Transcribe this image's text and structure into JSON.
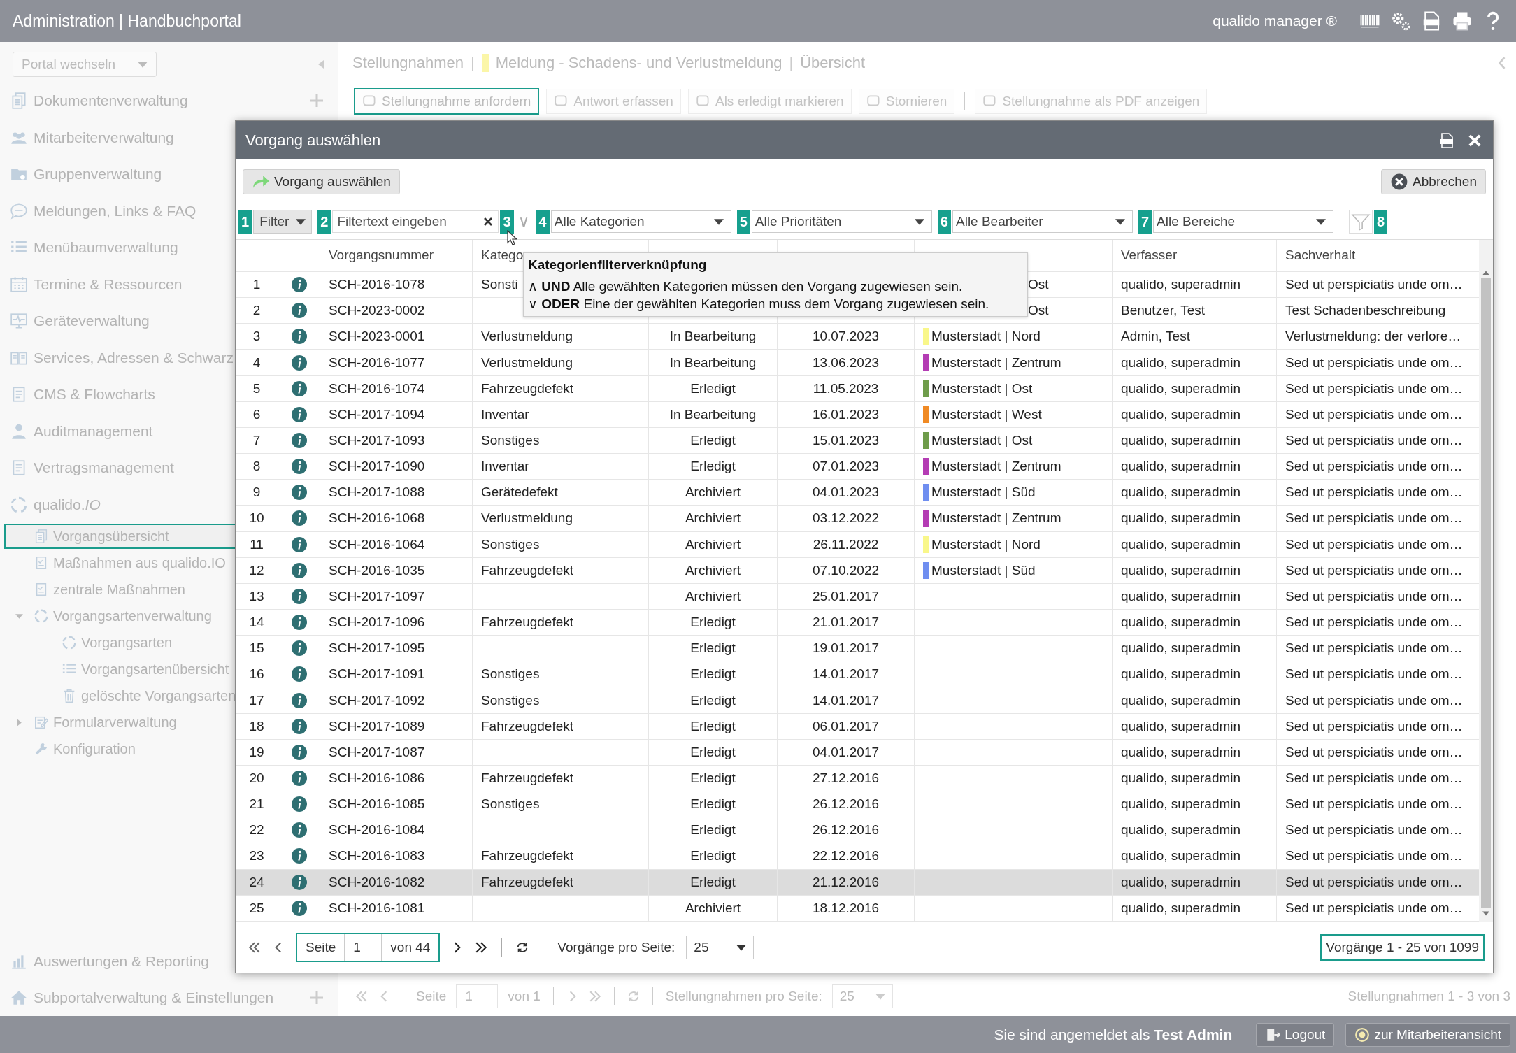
{
  "header": {
    "title": "Administration | Handbuchportal",
    "product": "qualido manager ®"
  },
  "sidebar": {
    "portal_select": "Portal wechseln",
    "items": [
      {
        "label": "Dokumentenverwaltung",
        "add": true
      },
      {
        "label": "Mitarbeiterverwaltung"
      },
      {
        "label": "Gruppenverwaltung"
      },
      {
        "label": "Meldungen, Links & FAQ"
      },
      {
        "label": "Menübaumverwaltung"
      },
      {
        "label": "Termine & Ressourcen"
      },
      {
        "label": "Geräteverwaltung"
      },
      {
        "label": "Services, Adressen & Schwarz"
      },
      {
        "label": "CMS & Flowcharts"
      },
      {
        "label": "Auditmanagement"
      },
      {
        "label": "Vertragsmanagement"
      }
    ],
    "tree": {
      "label": "qualido.*IO*",
      "children": [
        {
          "label": "Vorgangsübersicht",
          "selected": true
        },
        {
          "label": "Maßnahmen aus qualido.IO",
          "selected": false
        },
        {
          "label": "zentrale Maßnahmen",
          "selected": false
        },
        {
          "label": "Vorgangsartenverwaltung",
          "selected": false,
          "expanded": true,
          "children": [
            {
              "label": "Vorgangsarten",
              "selected": false
            },
            {
              "label": "Vorgangsartenübersicht",
              "selected": false
            },
            {
              "label": "gelöschte Vorgangsarten",
              "selected": false
            }
          ]
        },
        {
          "label": "Formularverwaltung",
          "selected": false,
          "expanded": false
        },
        {
          "label": "Konfiguration",
          "selected": false
        }
      ]
    },
    "bottom_items": [
      {
        "label": "Auswertungen & Reporting"
      },
      {
        "label": "Subportalverwaltung & Einstellungen",
        "add": true
      }
    ]
  },
  "main": {
    "breadcrumb": [
      {
        "kind": "text",
        "text": "Stellungnahmen"
      },
      {
        "kind": "sep",
        "text": "|"
      },
      {
        "kind": "tagged",
        "text": "Meldung - Schadens- und Verlustmeldung",
        "color": "#fbf6a8"
      },
      {
        "kind": "sep",
        "text": "|"
      },
      {
        "kind": "text",
        "text": "Übersicht"
      }
    ],
    "toolbar": [
      [
        {
          "label": "Stellungnahme anfordern",
          "focused": true
        },
        {
          "label": "Antwort erfassen",
          "focused": false
        },
        {
          "label": "Als erledigt markieren",
          "focused": false
        },
        {
          "label": "Stornieren",
          "focused": false
        }
      ],
      [
        {
          "label": "Stellungnahme als PDF anzeigen",
          "focused": false
        }
      ]
    ],
    "pager": {
      "page_label": "Seite",
      "page": "1",
      "of": "von 1",
      "per_page_label": "Stellungnahmen pro Seite:",
      "per_page": "25",
      "summary": "Stellungnahmen 1 - 3 von 3"
    }
  },
  "footer": {
    "text": "Sie sind angemeldet als **Test Admin**",
    "logout": "Logout",
    "employee_view": "zur Mitarbeiteransicht"
  },
  "modal": {
    "title": "Vorgang auswählen",
    "select_button": "Vorgang auswählen",
    "cancel_button": "Abbrechen",
    "filters": [
      {
        "badge": "1",
        "kind": "dropdown",
        "label": "Filter"
      },
      {
        "badge": "2",
        "kind": "text",
        "placeholder": "Filtertext eingeben"
      },
      {
        "badge": "3",
        "kind": "toggle",
        "label": "∨"
      },
      {
        "badge": "4",
        "kind": "select",
        "label": "Alle Kategorien"
      },
      {
        "badge": "5",
        "kind": "select",
        "label": "Alle Prioritäten"
      },
      {
        "badge": "6",
        "kind": "select",
        "label": "Alle Bearbeiter"
      },
      {
        "badge": "7",
        "kind": "select",
        "label": "Alle Bereiche"
      },
      {
        "badge": "8",
        "kind": "funnel"
      }
    ],
    "headers": {
      "vorgangsnummer": "Vorgangsnummer",
      "column_4": "Katego",
      "verfasser": "Verfasser",
      "sachverhalt": "Sachverhalt"
    },
    "rows": [
      {
        "n": "1",
        "vorgangsnummer": "SCH-2016-1078",
        "column_4": "Sonsti",
        "column_7": "Ost",
        "covered": true,
        "verfasser": "qualido, superadmin",
        "sachverhalt": "Sed ut perspiciatis unde om…",
        "selected": false
      },
      {
        "n": "2",
        "vorgangsnummer": "SCH-2023-0002",
        "column_7": "Ost",
        "covered": true,
        "verfasser": "Benutzer, Test",
        "sachverhalt": "Test Schadenbeschreibung",
        "selected": false
      },
      {
        "n": "3",
        "vorgangsnummer": "SCH-2023-0001",
        "column_4": "Verlustmeldung",
        "column_5": "In Bearbeitung",
        "column_6": "10.07.2023",
        "column_7": "Musterstadt | Nord",
        "color": "#f9f78a",
        "verfasser": "Admin, Test",
        "sachverhalt": "Verlustmeldung: der verlore…",
        "selected": false
      },
      {
        "n": "4",
        "vorgangsnummer": "SCH-2016-1077",
        "column_4": "Verlustmeldung",
        "column_5": "In Bearbeitung",
        "column_6": "13.06.2023",
        "column_7": "Musterstadt | Zentrum",
        "color": "#b43cb4",
        "verfasser": "qualido, superadmin",
        "sachverhalt": "Sed ut perspiciatis unde om…",
        "selected": false
      },
      {
        "n": "5",
        "vorgangsnummer": "SCH-2016-1074",
        "column_4": "Fahrzeugdefekt",
        "column_5": "Erledigt",
        "column_6": "11.05.2023",
        "column_7": "Musterstadt | Ost",
        "color": "#6e9c4a",
        "verfasser": "qualido, superadmin",
        "sachverhalt": "Sed ut perspiciatis unde om…",
        "selected": false
      },
      {
        "n": "6",
        "vorgangsnummer": "SCH-2017-1094",
        "column_4": "Inventar",
        "column_5": "In Bearbeitung",
        "column_6": "16.01.2023",
        "column_7": "Musterstadt | West",
        "color": "#f08a24",
        "verfasser": "qualido, superadmin",
        "sachverhalt": "Sed ut perspiciatis unde om…",
        "selected": false
      },
      {
        "n": "7",
        "vorgangsnummer": "SCH-2017-1093",
        "column_4": "Sonstiges",
        "column_5": "Erledigt",
        "column_6": "15.01.2023",
        "column_7": "Musterstadt | Ost",
        "color": "#6e9c4a",
        "verfasser": "qualido, superadmin",
        "sachverhalt": "Sed ut perspiciatis unde om…",
        "selected": false
      },
      {
        "n": "8",
        "vorgangsnummer": "SCH-2017-1090",
        "column_4": "Inventar",
        "column_5": "Erledigt",
        "column_6": "07.01.2023",
        "column_7": "Musterstadt | Zentrum",
        "color": "#b43cb4",
        "verfasser": "qualido, superadmin",
        "sachverhalt": "Sed ut perspiciatis unde om…",
        "selected": false
      },
      {
        "n": "9",
        "vorgangsnummer": "SCH-2017-1088",
        "column_4": "Gerätedefekt",
        "column_5": "Archiviert",
        "column_6": "04.01.2023",
        "column_7": "Musterstadt | Süd",
        "color": "#6f8ef0",
        "verfasser": "qualido, superadmin",
        "sachverhalt": "Sed ut perspiciatis unde om…",
        "selected": false
      },
      {
        "n": "10",
        "vorgangsnummer": "SCH-2016-1068",
        "column_4": "Verlustmeldung",
        "column_5": "Archiviert",
        "column_6": "03.12.2022",
        "column_7": "Musterstadt | Zentrum",
        "color": "#b43cb4",
        "verfasser": "qualido, superadmin",
        "sachverhalt": "Sed ut perspiciatis unde om…",
        "selected": false
      },
      {
        "n": "11",
        "vorgangsnummer": "SCH-2016-1064",
        "column_4": "Sonstiges",
        "column_5": "Archiviert",
        "column_6": "26.11.2022",
        "column_7": "Musterstadt | Nord",
        "color": "#f9f78a",
        "verfasser": "qualido, superadmin",
        "sachverhalt": "Sed ut perspiciatis unde om…",
        "selected": false
      },
      {
        "n": "12",
        "vorgangsnummer": "SCH-2016-1035",
        "column_4": "Fahrzeugdefekt",
        "column_5": "Archiviert",
        "column_6": "07.10.2022",
        "column_7": "Musterstadt | Süd",
        "color": "#6f8ef0",
        "verfasser": "qualido, superadmin",
        "sachverhalt": "Sed ut perspiciatis unde om…",
        "selected": false
      },
      {
        "n": "13",
        "vorgangsnummer": "SCH-2017-1097",
        "column_5": "Archiviert",
        "column_6": "25.01.2017",
        "verfasser": "qualido, superadmin",
        "sachverhalt": "Sed ut perspiciatis unde om…",
        "selected": false
      },
      {
        "n": "14",
        "vorgangsnummer": "SCH-2017-1096",
        "column_4": "Fahrzeugdefekt",
        "column_5": "Erledigt",
        "column_6": "21.01.2017",
        "verfasser": "qualido, superadmin",
        "sachverhalt": "Sed ut perspiciatis unde om…",
        "selected": false
      },
      {
        "n": "15",
        "vorgangsnummer": "SCH-2017-1095",
        "column_5": "Erledigt",
        "column_6": "19.01.2017",
        "verfasser": "qualido, superadmin",
        "sachverhalt": "Sed ut perspiciatis unde om…",
        "selected": false
      },
      {
        "n": "16",
        "vorgangsnummer": "SCH-2017-1091",
        "column_4": "Sonstiges",
        "column_5": "Erledigt",
        "column_6": "14.01.2017",
        "verfasser": "qualido, superadmin",
        "sachverhalt": "Sed ut perspiciatis unde om…",
        "selected": false
      },
      {
        "n": "17",
        "vorgangsnummer": "SCH-2017-1092",
        "column_4": "Sonstiges",
        "column_5": "Erledigt",
        "column_6": "14.01.2017",
        "verfasser": "qualido, superadmin",
        "sachverhalt": "Sed ut perspiciatis unde om…",
        "selected": false
      },
      {
        "n": "18",
        "vorgangsnummer": "SCH-2017-1089",
        "column_4": "Fahrzeugdefekt",
        "column_5": "Erledigt",
        "column_6": "06.01.2017",
        "verfasser": "qualido, superadmin",
        "sachverhalt": "Sed ut perspiciatis unde om…",
        "selected": false
      },
      {
        "n": "19",
        "vorgangsnummer": "SCH-2017-1087",
        "column_5": "Erledigt",
        "column_6": "04.01.2017",
        "verfasser": "qualido, superadmin",
        "sachverhalt": "Sed ut perspiciatis unde om…",
        "selected": false
      },
      {
        "n": "20",
        "vorgangsnummer": "SCH-2016-1086",
        "column_4": "Fahrzeugdefekt",
        "column_5": "Erledigt",
        "column_6": "27.12.2016",
        "verfasser": "qualido, superadmin",
        "sachverhalt": "Sed ut perspiciatis unde om…",
        "selected": false
      },
      {
        "n": "21",
        "vorgangsnummer": "SCH-2016-1085",
        "column_4": "Sonstiges",
        "column_5": "Erledigt",
        "column_6": "26.12.2016",
        "verfasser": "qualido, superadmin",
        "sachverhalt": "Sed ut perspiciatis unde om…",
        "selected": false
      },
      {
        "n": "22",
        "vorgangsnummer": "SCH-2016-1084",
        "column_5": "Erledigt",
        "column_6": "26.12.2016",
        "verfasser": "qualido, superadmin",
        "sachverhalt": "Sed ut perspiciatis unde om…",
        "selected": false
      },
      {
        "n": "23",
        "vorgangsnummer": "SCH-2016-1083",
        "column_4": "Fahrzeugdefekt",
        "column_5": "Erledigt",
        "column_6": "22.12.2016",
        "verfasser": "qualido, superadmin",
        "sachverhalt": "Sed ut perspiciatis unde om…",
        "selected": false
      },
      {
        "n": "24",
        "vorgangsnummer": "SCH-2016-1082",
        "column_4": "Fahrzeugdefekt",
        "column_5": "Erledigt",
        "column_6": "21.12.2016",
        "verfasser": "qualido, superadmin",
        "sachverhalt": "Sed ut perspiciatis unde om…",
        "selected": true
      },
      {
        "n": "25",
        "vorgangsnummer": "SCH-2016-1081",
        "column_5": "Archiviert",
        "column_6": "18.12.2016",
        "verfasser": "qualido, superadmin",
        "sachverhalt": "Sed ut perspiciatis unde om…",
        "selected": false
      }
    ],
    "tooltip": {
      "title": "Kategorienfilterverknüpfung",
      "lines": [
        "∧ **UND** Alle gewählten Kategorien müssen den Vorgang zugewiesen sein.",
        "∨ **ODER** Eine der gewählten Kategorien muss dem Vorgang zugewiesen sein."
      ]
    },
    "pager": {
      "page_label": "Seite",
      "page": "1",
      "of": "von 44",
      "per_page_label": "Vorgänge pro Seite:",
      "per_page": "25",
      "summary": "Vorgänge 1 - 25 von 1099"
    }
  }
}
